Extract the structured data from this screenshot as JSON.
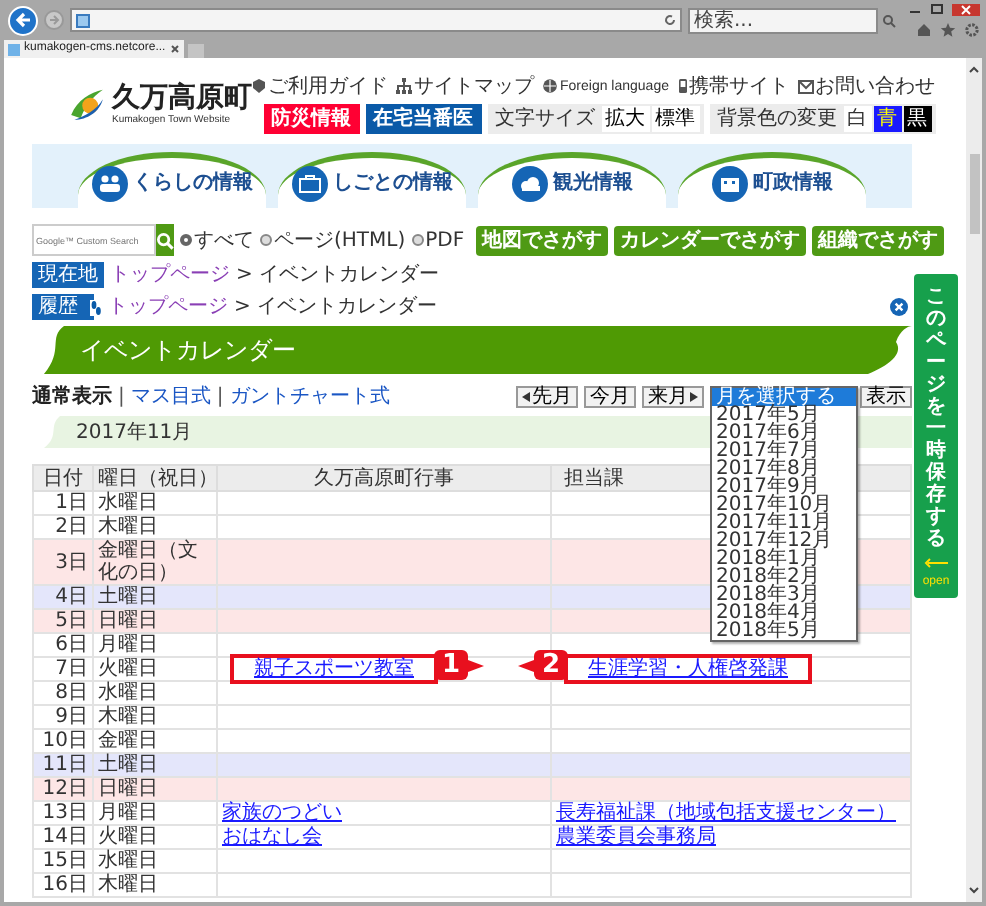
{
  "browser": {
    "tab_title": "kumakogen-cms.netcore...",
    "search_placeholder": "検索..."
  },
  "header": {
    "logo_title": "久万高原町",
    "logo_subtitle": "Kumakogen Town Website",
    "utility_links": [
      {
        "label": "ご利用ガイド",
        "kind": "guide"
      },
      {
        "label": "サイトマップ",
        "kind": "sitemap"
      },
      {
        "label": "Foreign language",
        "kind": "globe"
      },
      {
        "label": "携帯サイト",
        "kind": "mobile"
      },
      {
        "label": "お問い合わせ",
        "kind": "mail"
      }
    ],
    "alert_buttons": [
      {
        "label": "防災情報",
        "color": "#ff0033"
      },
      {
        "label": "在宅当番医",
        "color": "#0a5aa8"
      }
    ],
    "font_size": {
      "label": "文字サイズ",
      "options": [
        "拡大",
        "標準"
      ]
    },
    "bg_color": {
      "label": "背景色の変更",
      "options": [
        {
          "label": "白",
          "kind": "white"
        },
        {
          "label": "青",
          "kind": "blue"
        },
        {
          "label": "黒",
          "kind": "black"
        }
      ]
    }
  },
  "nav_tabs": [
    {
      "label": "くらしの情報",
      "kind": "people"
    },
    {
      "label": "しごとの情報",
      "kind": "briefcase"
    },
    {
      "label": "観光情報",
      "kind": "cloud"
    },
    {
      "label": "町政情報",
      "kind": "building"
    }
  ],
  "search": {
    "placeholder": "Google™ Custom Search",
    "scopes": [
      {
        "label": "すべて",
        "selected": true
      },
      {
        "label": "ページ(HTML)",
        "selected": false
      },
      {
        "label": "PDF",
        "selected": false
      }
    ],
    "finders": [
      "地図でさがす",
      "カレンダーでさがす",
      "組織でさがす"
    ]
  },
  "breadcrumbs": [
    {
      "badge": "現在地",
      "kind": "current",
      "link": "トップページ",
      "current": "> イベントカレンダー"
    },
    {
      "badge": "履歴",
      "kind": "history",
      "link": "トップページ",
      "current": "> イベントカレンダー"
    }
  ],
  "page_title": "イベントカレンダー",
  "view_modes": [
    {
      "label": "通常表示",
      "selected": true
    },
    {
      "label": "マス目式",
      "selected": false
    },
    {
      "label": "ガントチャート式",
      "selected": false
    }
  ],
  "view_mode_separators": [
    "|",
    "|"
  ],
  "month_nav": {
    "prev": "先月",
    "current": "今月",
    "next": "来月",
    "show_button": "表示",
    "options": [
      {
        "label": "月を選択する",
        "selected": true
      },
      {
        "label": "2017年5月",
        "selected": false
      },
      {
        "label": "2017年6月",
        "selected": false
      },
      {
        "label": "2017年7月",
        "selected": false
      },
      {
        "label": "2017年8月",
        "selected": false
      },
      {
        "label": "2017年9月",
        "selected": false
      },
      {
        "label": "2017年10月",
        "selected": false
      },
      {
        "label": "2017年11月",
        "selected": false
      },
      {
        "label": "2017年12月",
        "selected": false
      },
      {
        "label": "2018年1月",
        "selected": false
      },
      {
        "label": "2018年2月",
        "selected": false
      },
      {
        "label": "2018年3月",
        "selected": false
      },
      {
        "label": "2018年4月",
        "selected": false
      },
      {
        "label": "2018年5月",
        "selected": false
      }
    ]
  },
  "month_heading": "2017年11月",
  "save_tab": {
    "label": "このページを一時保存する",
    "open": "open"
  },
  "table": {
    "columns": [
      "日付",
      "曜日（祝日）",
      "久万高原町行事",
      "担当課"
    ],
    "rows": [
      {
        "date": "1日",
        "weekday": "水曜日",
        "kind": "weekday",
        "events": [],
        "departments": []
      },
      {
        "date": "2日",
        "weekday": "木曜日",
        "kind": "weekday",
        "events": [],
        "departments": []
      },
      {
        "date": "3日",
        "weekday": "金曜日（文化の日）",
        "kind": "holiday",
        "events": [],
        "departments": []
      },
      {
        "date": "4日",
        "weekday": "土曜日",
        "kind": "saturday",
        "events": [],
        "departments": []
      },
      {
        "date": "5日",
        "weekday": "日曜日",
        "kind": "holiday",
        "events": [],
        "departments": []
      },
      {
        "date": "6日",
        "weekday": "月曜日",
        "kind": "weekday",
        "events": [],
        "departments": []
      },
      {
        "date": "7日",
        "weekday": "火曜日",
        "kind": "weekday",
        "events": [
          {
            "text": "親子スポーツ教室",
            "callout": "1"
          }
        ],
        "departments": [
          {
            "text": "生涯学習・人権啓発課",
            "callout": "2"
          }
        ]
      },
      {
        "date": "8日",
        "weekday": "水曜日",
        "kind": "weekday",
        "events": [],
        "departments": []
      },
      {
        "date": "9日",
        "weekday": "木曜日",
        "kind": "weekday",
        "events": [],
        "departments": []
      },
      {
        "date": "10日",
        "weekday": "金曜日",
        "kind": "weekday",
        "events": [],
        "departments": []
      },
      {
        "date": "11日",
        "weekday": "土曜日",
        "kind": "saturday",
        "events": [],
        "departments": []
      },
      {
        "date": "12日",
        "weekday": "日曜日",
        "kind": "holiday",
        "events": [],
        "departments": []
      },
      {
        "date": "13日",
        "weekday": "月曜日",
        "kind": "weekday",
        "events": [
          {
            "text": "家族のつどい"
          }
        ],
        "departments": [
          {
            "text": "長寿福祉課（地域包括支援センター）"
          }
        ]
      },
      {
        "date": "14日",
        "weekday": "火曜日",
        "kind": "weekday",
        "events": [
          {
            "text": "おはなし会"
          }
        ],
        "departments": [
          {
            "text": "農業委員会事務局"
          }
        ]
      },
      {
        "date": "15日",
        "weekday": "水曜日",
        "kind": "weekday",
        "events": [],
        "departments": []
      },
      {
        "date": "16日",
        "weekday": "木曜日",
        "kind": "weekday",
        "events": [],
        "departments": []
      }
    ]
  }
}
